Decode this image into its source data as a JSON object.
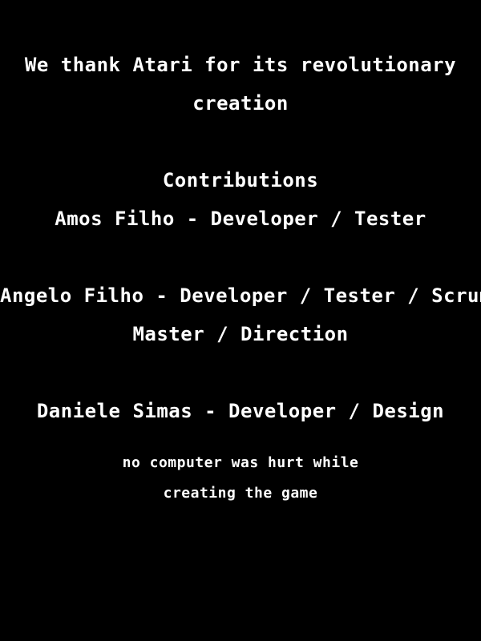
{
  "credits": {
    "thanks_line1": "We thank Atari for its revolutionary",
    "thanks_line2": "creation",
    "contributions_heading": "Contributions",
    "contributor1": "Amos Filho - Developer / Tester",
    "contributor2_line1": "Angelo Filho - Developer / Tester / Scrum",
    "contributor2_line2": "Master / Direction",
    "contributor3": "Daniele Simas - Developer / Design",
    "footnote_line1": "no computer was hurt while",
    "footnote_line2": "creating the game"
  },
  "colors": {
    "background": "#000000",
    "text": "#ffffff"
  }
}
